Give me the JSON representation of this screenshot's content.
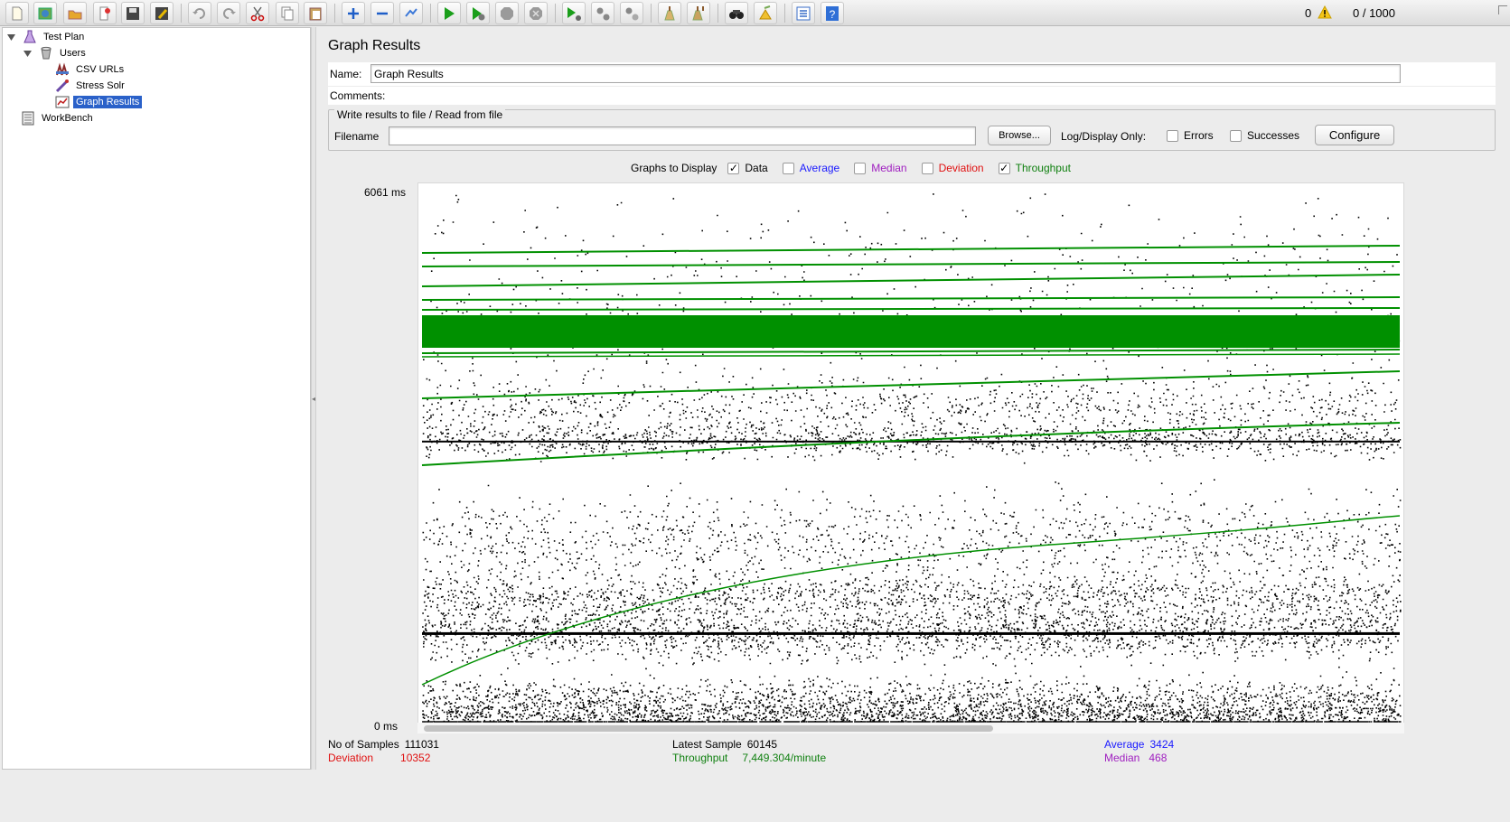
{
  "toolbar": {
    "buttons": [
      "new-icon",
      "templates-icon",
      "open-icon",
      "close-icon",
      "save-icon",
      "save-as-icon",
      "undo-icon",
      "redo-icon",
      "cut-icon",
      "copy-icon",
      "paste-icon",
      "expand-icon",
      "collapse-icon",
      "toggle-icon",
      "start-icon",
      "start-no-timers-icon",
      "stop-icon",
      "shutdown-icon",
      "remote-start-icon",
      "remote-stop-icon",
      "remote-shutdown-icon",
      "clear-icon",
      "clear-all-icon",
      "search-icon",
      "reset-search-icon",
      "function-helper-icon",
      "help-icon"
    ],
    "error_count": "0",
    "thread_status": "0 / 1000"
  },
  "tree": {
    "nodes": [
      {
        "label": "Test Plan",
        "icon": "test-plan-icon"
      },
      {
        "label": "Users",
        "icon": "thread-group-icon"
      },
      {
        "label": "CSV URLs",
        "icon": "csv-config-icon"
      },
      {
        "label": "Stress Solr",
        "icon": "http-sampler-icon"
      },
      {
        "label": "Graph Results",
        "icon": "graph-results-icon"
      },
      {
        "label": "WorkBench",
        "icon": "workbench-icon"
      }
    ]
  },
  "panel": {
    "title": "Graph Results",
    "name_label": "Name:",
    "name_value": "Graph Results",
    "comments_label": "Comments:",
    "file_group_title": "Write results to file / Read from file",
    "filename_label": "Filename",
    "filename_value": "",
    "browse_label": "Browse...",
    "log_display_label": "Log/Display Only:",
    "errors_label": "Errors",
    "successes_label": "Successes",
    "configure_label": "Configure"
  },
  "graphs": {
    "label": "Graphs to Display",
    "options": [
      {
        "label": "Data",
        "checked": true,
        "color": "#000000"
      },
      {
        "label": "Average",
        "checked": false,
        "color": "#1a1aff"
      },
      {
        "label": "Median",
        "checked": false,
        "color": "#a020c0"
      },
      {
        "label": "Deviation",
        "checked": false,
        "color": "#e01010"
      },
      {
        "label": "Throughput",
        "checked": true,
        "color": "#108010"
      }
    ]
  },
  "chart_data": {
    "type": "scatter",
    "ylabel_top": "6061 ms",
    "ylabel_bottom": "0 ms",
    "ylim": [
      0,
      6061
    ],
    "data_color": "#000000",
    "throughput_color": "#009000"
  },
  "stats": {
    "samples_label": "No of Samples",
    "samples_value": "111031",
    "deviation_label": "Deviation",
    "deviation_value": "10352",
    "latest_label": "Latest Sample",
    "latest_value": "60145",
    "throughput_label": "Throughput",
    "throughput_value": "7,449.304/minute",
    "average_label": "Average",
    "average_value": "3424",
    "median_label": "Median",
    "median_value": "468"
  }
}
